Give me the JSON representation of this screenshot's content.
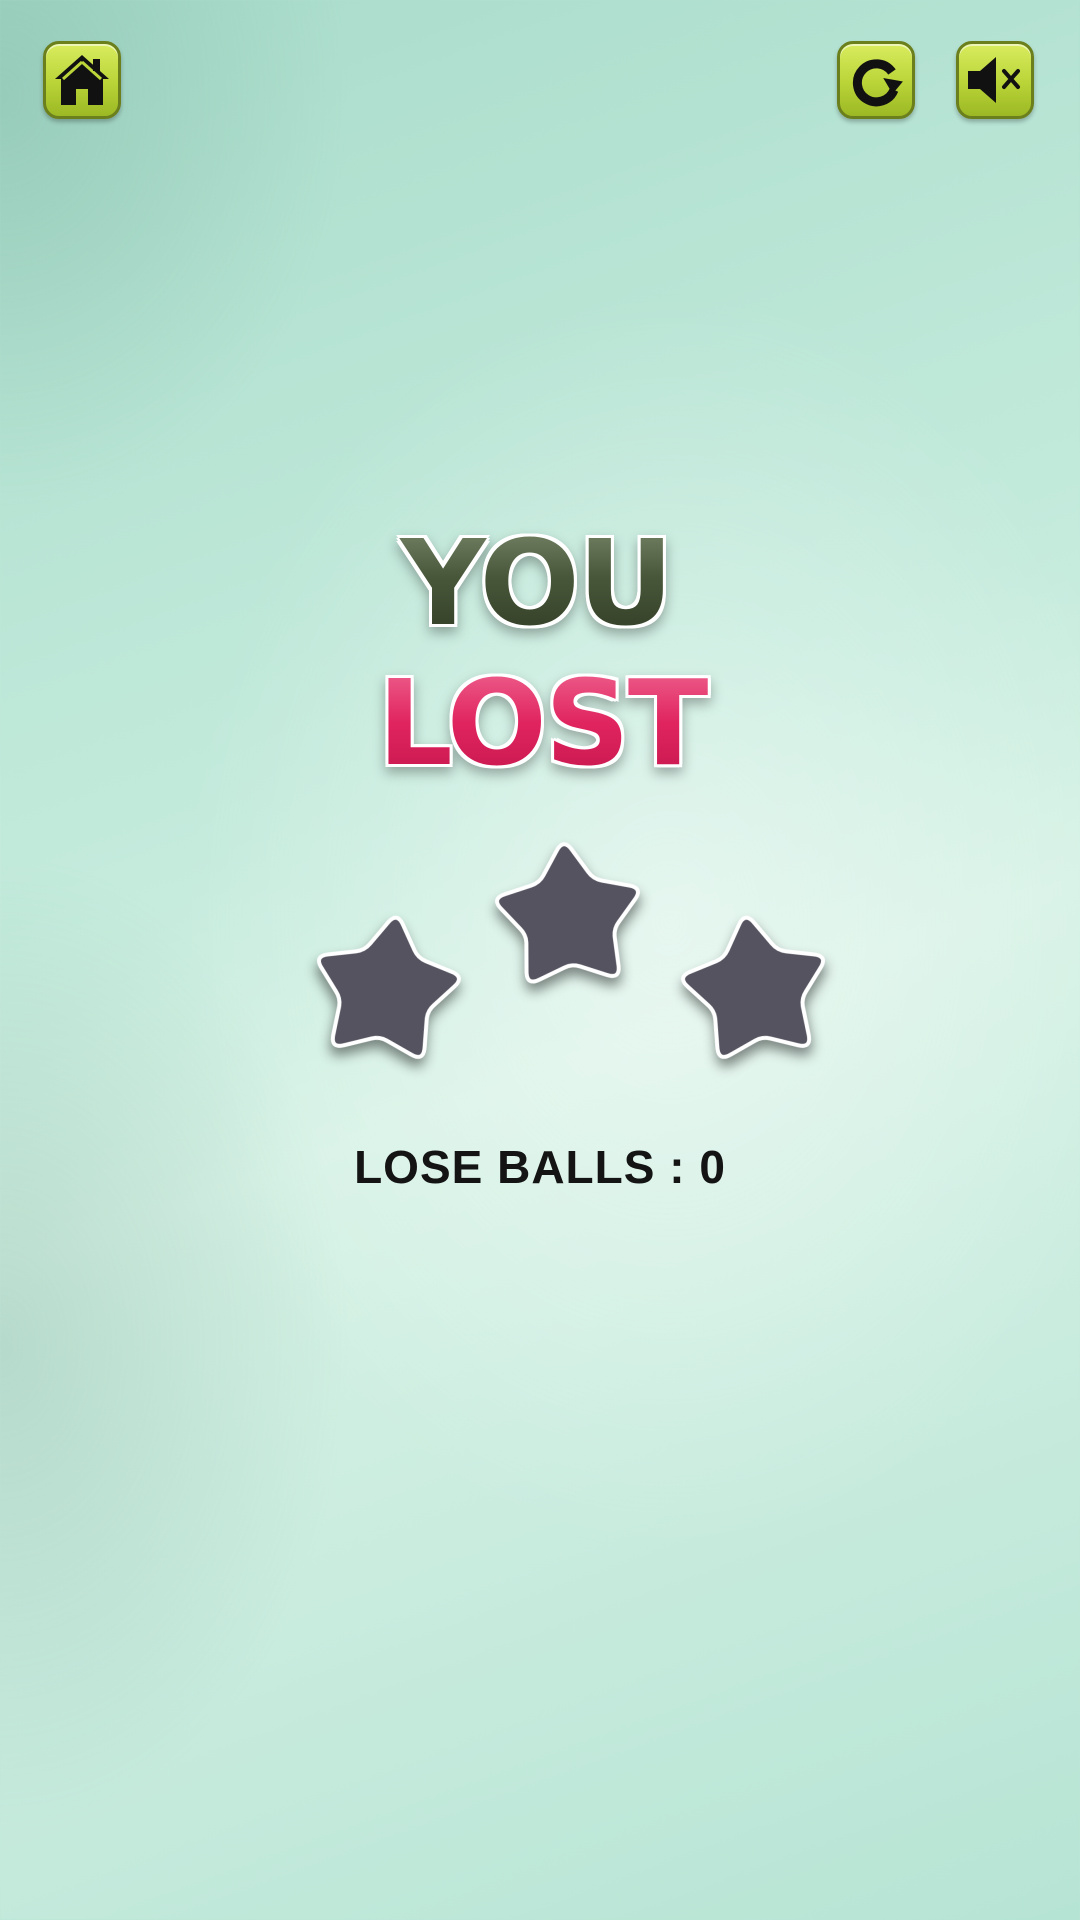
{
  "header": {
    "home_icon": "home-icon",
    "restart_icon": "restart-icon",
    "mute_icon": "sound-muted-icon"
  },
  "result": {
    "title_line1": "YOU",
    "title_line2": "LOST",
    "stars_total": 3,
    "stars_earned": 0,
    "star_color": "#555360",
    "score_label": "LOSE BALLS",
    "score_separator": ":",
    "score_value": "0"
  },
  "colors": {
    "button_fill": "#bcd63a",
    "button_border": "#6b7f1c",
    "lost_color": "#e0245f",
    "you_color": "#48573a",
    "background": "#c4ebdc"
  }
}
